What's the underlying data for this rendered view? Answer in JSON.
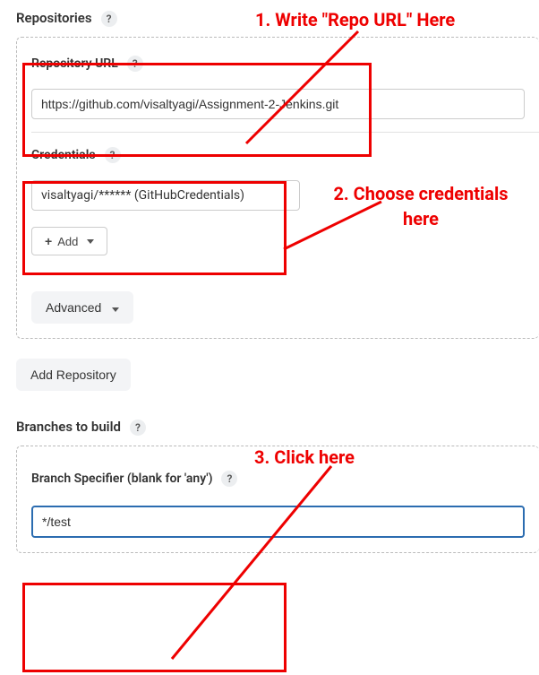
{
  "sections": {
    "repositories_label": "Repositories",
    "branches_label": "Branches to build"
  },
  "fields": {
    "repo_url_label": "Repository URL",
    "repo_url_value": "https://github.com/visaltyagi/Assignment-2-Jenkins.git",
    "credentials_label": "Credentials",
    "credentials_value": "visaltyagi/****** (GitHubCredentials)",
    "branch_specifier_label": "Branch Specifier (blank for 'any')",
    "branch_specifier_value": "*/test"
  },
  "buttons": {
    "add_label": "Add",
    "advanced_label": "Advanced",
    "add_repository_label": "Add Repository"
  },
  "annotations": {
    "step1": "1. Write \"Repo URL\" Here",
    "step2": "2. Choose credentials here",
    "step3": "3. Click here"
  },
  "help_glyph": "?"
}
